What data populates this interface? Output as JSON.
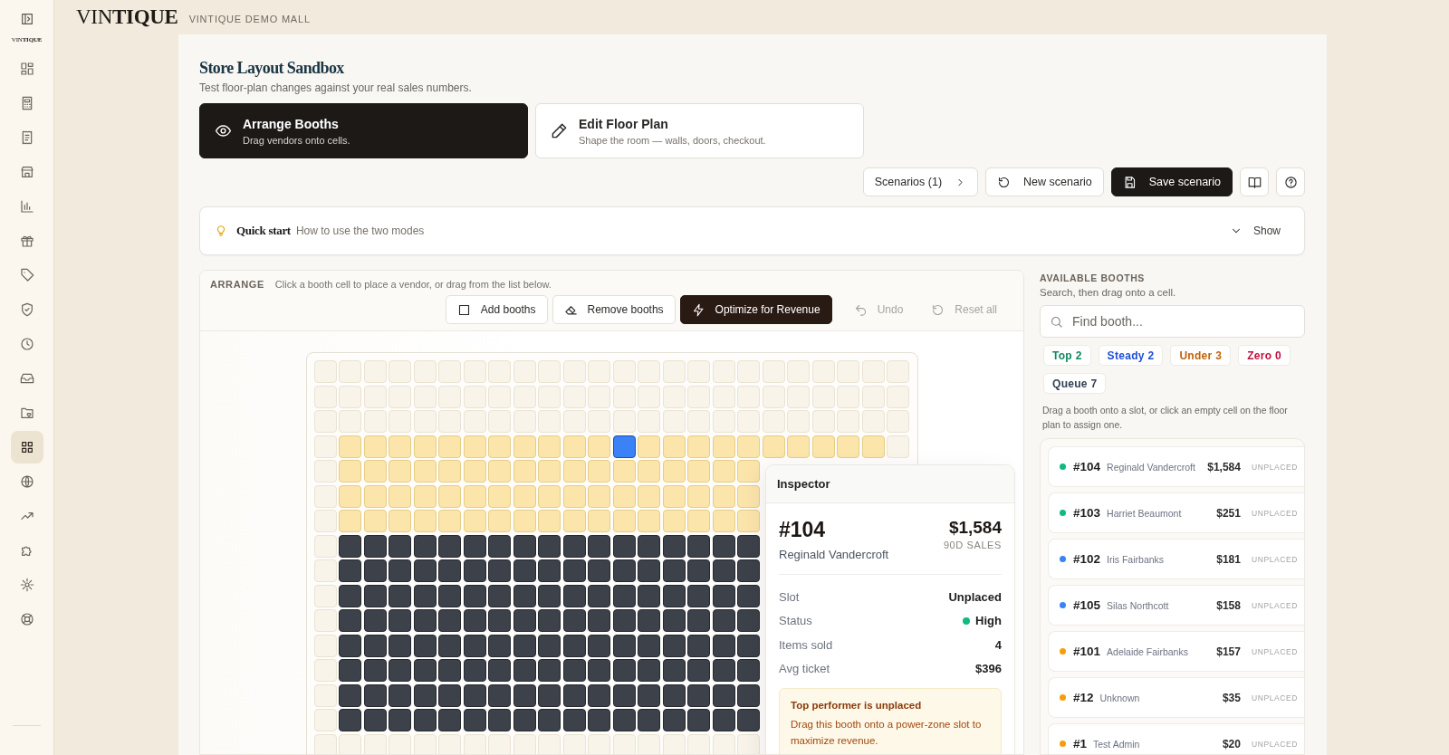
{
  "header": {
    "brand": "VIN**TIQUE**",
    "mall": "VINTIQUE DEMO MALL"
  },
  "sidebar": {
    "logo": "VIN**TIQUE**",
    "items": [
      {
        "selected": false
      },
      {
        "selected": false
      },
      {
        "selected": false
      },
      {
        "selected": false
      },
      {
        "selected": false
      },
      {
        "selected": false
      },
      {
        "selected": false
      },
      {
        "selected": false
      },
      {
        "selected": false
      },
      {
        "selected": false
      },
      {
        "selected": false
      },
      {
        "selected": true
      },
      {
        "selected": false
      },
      {
        "selected": false
      },
      {
        "selected": false
      },
      {
        "selected": false
      },
      {
        "selected": false
      }
    ]
  },
  "page": {
    "title": "Store Layout Sandbox",
    "subtitle": "Test floor-plan changes against your real sales numbers."
  },
  "modes": [
    {
      "title": "Arrange Booths",
      "subtitle": "Drag vendors onto cells.",
      "kind": "arrange",
      "selected": true
    },
    {
      "title": "Edit Floor Plan",
      "subtitle": "Shape the room — walls, doors, checkout.",
      "kind": "edit",
      "selected": false
    }
  ],
  "actions": [
    {
      "label": "Scenarios (1)",
      "kind": "menu"
    },
    {
      "label": "New scenario",
      "kind": "new"
    },
    {
      "label": "Save scenario",
      "kind": "save"
    }
  ],
  "quick_start": {
    "title": "Quick start",
    "description": "How to use the two modes",
    "toggle": "Show",
    "expanded": false
  },
  "arrange": {
    "label": "ARRANGE",
    "hint": "Click a booth cell to place a vendor, or drag from the list below.",
    "tools": [
      {
        "label": "Add booths",
        "kind": "add",
        "disabled": false
      },
      {
        "label": "Remove booths",
        "kind": "remove",
        "disabled": false
      },
      {
        "label": "Optimize for Revenue",
        "kind": "optimize",
        "disabled": false
      },
      {
        "label": "Undo",
        "kind": "undo",
        "disabled": true
      },
      {
        "label": "Reset all",
        "kind": "reset",
        "disabled": true
      }
    ]
  },
  "floor_plan": {
    "rows": [
      {
        "cells": [
          {
            "kind": "empty"
          },
          {
            "kind": "empty"
          },
          {
            "kind": "empty"
          },
          {
            "kind": "empty"
          },
          {
            "kind": "empty"
          },
          {
            "kind": "empty"
          },
          {
            "kind": "empty"
          },
          {
            "kind": "empty"
          },
          {
            "kind": "empty"
          },
          {
            "kind": "empty"
          },
          {
            "kind": "empty"
          },
          {
            "kind": "empty"
          },
          {
            "kind": "empty"
          },
          {
            "kind": "empty"
          },
          {
            "kind": "empty"
          },
          {
            "kind": "empty"
          },
          {
            "kind": "empty"
          },
          {
            "kind": "empty"
          },
          {
            "kind": "empty"
          },
          {
            "kind": "empty"
          },
          {
            "kind": "empty"
          },
          {
            "kind": "empty"
          },
          {
            "kind": "empty"
          },
          {
            "kind": "empty"
          }
        ]
      },
      {
        "cells": [
          {
            "kind": "empty"
          },
          {
            "kind": "empty"
          },
          {
            "kind": "empty"
          },
          {
            "kind": "empty"
          },
          {
            "kind": "empty"
          },
          {
            "kind": "empty"
          },
          {
            "kind": "empty"
          },
          {
            "kind": "empty"
          },
          {
            "kind": "empty"
          },
          {
            "kind": "empty"
          },
          {
            "kind": "empty"
          },
          {
            "kind": "empty"
          },
          {
            "kind": "empty"
          },
          {
            "kind": "empty"
          },
          {
            "kind": "empty"
          },
          {
            "kind": "empty"
          },
          {
            "kind": "empty"
          },
          {
            "kind": "empty"
          },
          {
            "kind": "empty"
          },
          {
            "kind": "empty"
          },
          {
            "kind": "empty"
          },
          {
            "kind": "empty"
          },
          {
            "kind": "empty"
          },
          {
            "kind": "empty"
          }
        ]
      },
      {
        "cells": [
          {
            "kind": "empty"
          },
          {
            "kind": "empty"
          },
          {
            "kind": "empty"
          },
          {
            "kind": "empty"
          },
          {
            "kind": "empty"
          },
          {
            "kind": "empty"
          },
          {
            "kind": "empty"
          },
          {
            "kind": "empty"
          },
          {
            "kind": "empty"
          },
          {
            "kind": "empty"
          },
          {
            "kind": "empty"
          },
          {
            "kind": "empty"
          },
          {
            "kind": "empty"
          },
          {
            "kind": "empty"
          },
          {
            "kind": "empty"
          },
          {
            "kind": "empty"
          },
          {
            "kind": "empty"
          },
          {
            "kind": "empty"
          },
          {
            "kind": "empty"
          },
          {
            "kind": "empty"
          },
          {
            "kind": "empty"
          },
          {
            "kind": "empty"
          },
          {
            "kind": "empty"
          },
          {
            "kind": "empty"
          }
        ]
      },
      {
        "cells": [
          {
            "kind": "empty"
          },
          {
            "kind": "power"
          },
          {
            "kind": "power"
          },
          {
            "kind": "power"
          },
          {
            "kind": "power"
          },
          {
            "kind": "power"
          },
          {
            "kind": "power"
          },
          {
            "kind": "power"
          },
          {
            "kind": "power"
          },
          {
            "kind": "power"
          },
          {
            "kind": "power"
          },
          {
            "kind": "power"
          },
          {
            "kind": "selected"
          },
          {
            "kind": "power"
          },
          {
            "kind": "power"
          },
          {
            "kind": "power"
          },
          {
            "kind": "power"
          },
          {
            "kind": "power"
          },
          {
            "kind": "power"
          },
          {
            "kind": "power"
          },
          {
            "kind": "power"
          },
          {
            "kind": "power"
          },
          {
            "kind": "power"
          },
          {
            "kind": "empty"
          }
        ]
      },
      {
        "cells": [
          {
            "kind": "empty"
          },
          {
            "kind": "power"
          },
          {
            "kind": "power"
          },
          {
            "kind": "power"
          },
          {
            "kind": "power"
          },
          {
            "kind": "power"
          },
          {
            "kind": "power"
          },
          {
            "kind": "power"
          },
          {
            "kind": "power"
          },
          {
            "kind": "power"
          },
          {
            "kind": "power"
          },
          {
            "kind": "power"
          },
          {
            "kind": "power"
          },
          {
            "kind": "power"
          },
          {
            "kind": "power"
          },
          {
            "kind": "power"
          },
          {
            "kind": "power"
          },
          {
            "kind": "power"
          }
        ]
      },
      {
        "cells": [
          {
            "kind": "empty"
          },
          {
            "kind": "power"
          },
          {
            "kind": "power"
          },
          {
            "kind": "power"
          },
          {
            "kind": "power"
          },
          {
            "kind": "power"
          },
          {
            "kind": "power"
          },
          {
            "kind": "power"
          },
          {
            "kind": "power"
          },
          {
            "kind": "power"
          },
          {
            "kind": "power"
          },
          {
            "kind": "power"
          },
          {
            "kind": "power"
          },
          {
            "kind": "power"
          },
          {
            "kind": "power"
          },
          {
            "kind": "power"
          },
          {
            "kind": "power"
          },
          {
            "kind": "power"
          }
        ]
      },
      {
        "cells": [
          {
            "kind": "empty"
          },
          {
            "kind": "power"
          },
          {
            "kind": "power"
          },
          {
            "kind": "power"
          },
          {
            "kind": "power"
          },
          {
            "kind": "power"
          },
          {
            "kind": "power"
          },
          {
            "kind": "power"
          },
          {
            "kind": "power"
          },
          {
            "kind": "power"
          },
          {
            "kind": "power"
          },
          {
            "kind": "power"
          },
          {
            "kind": "power"
          },
          {
            "kind": "power"
          },
          {
            "kind": "power"
          },
          {
            "kind": "power"
          },
          {
            "kind": "power"
          },
          {
            "kind": "power"
          }
        ]
      },
      {
        "cells": [
          {
            "kind": "empty"
          },
          {
            "kind": "standard"
          },
          {
            "kind": "standard"
          },
          {
            "kind": "standard"
          },
          {
            "kind": "standard"
          },
          {
            "kind": "standard"
          },
          {
            "kind": "standard"
          },
          {
            "kind": "standard"
          },
          {
            "kind": "standard"
          },
          {
            "kind": "standard"
          },
          {
            "kind": "standard"
          },
          {
            "kind": "standard"
          },
          {
            "kind": "standard"
          },
          {
            "kind": "standard"
          },
          {
            "kind": "standard"
          },
          {
            "kind": "standard"
          },
          {
            "kind": "standard"
          },
          {
            "kind": "standard"
          }
        ]
      },
      {
        "cells": [
          {
            "kind": "empty"
          },
          {
            "kind": "standard"
          },
          {
            "kind": "standard"
          },
          {
            "kind": "standard"
          },
          {
            "kind": "standard"
          },
          {
            "kind": "standard"
          },
          {
            "kind": "standard"
          },
          {
            "kind": "standard"
          },
          {
            "kind": "standard"
          },
          {
            "kind": "standard"
          },
          {
            "kind": "standard"
          },
          {
            "kind": "standard"
          },
          {
            "kind": "standard"
          },
          {
            "kind": "standard"
          },
          {
            "kind": "standard"
          },
          {
            "kind": "standard"
          },
          {
            "kind": "standard"
          },
          {
            "kind": "standard"
          }
        ]
      },
      {
        "cells": [
          {
            "kind": "empty"
          },
          {
            "kind": "standard"
          },
          {
            "kind": "standard"
          },
          {
            "kind": "standard"
          },
          {
            "kind": "standard"
          },
          {
            "kind": "standard"
          },
          {
            "kind": "standard"
          },
          {
            "kind": "standard"
          },
          {
            "kind": "standard"
          },
          {
            "kind": "standard"
          },
          {
            "kind": "standard"
          },
          {
            "kind": "standard"
          },
          {
            "kind": "standard"
          },
          {
            "kind": "standard"
          },
          {
            "kind": "standard"
          },
          {
            "kind": "standard"
          },
          {
            "kind": "standard"
          },
          {
            "kind": "standard"
          }
        ]
      },
      {
        "cells": [
          {
            "kind": "empty"
          },
          {
            "kind": "standard"
          },
          {
            "kind": "standard"
          },
          {
            "kind": "standard"
          },
          {
            "kind": "standard"
          },
          {
            "kind": "standard"
          },
          {
            "kind": "standard"
          },
          {
            "kind": "standard"
          },
          {
            "kind": "standard"
          },
          {
            "kind": "standard"
          },
          {
            "kind": "standard"
          },
          {
            "kind": "standard"
          },
          {
            "kind": "standard"
          },
          {
            "kind": "standard"
          },
          {
            "kind": "standard"
          },
          {
            "kind": "standard"
          },
          {
            "kind": "standard"
          },
          {
            "kind": "standard"
          }
        ]
      },
      {
        "cells": [
          {
            "kind": "empty"
          },
          {
            "kind": "standard"
          },
          {
            "kind": "standard"
          },
          {
            "kind": "standard"
          },
          {
            "kind": "standard"
          },
          {
            "kind": "standard"
          },
          {
            "kind": "standard"
          },
          {
            "kind": "standard"
          },
          {
            "kind": "standard"
          },
          {
            "kind": "standard"
          },
          {
            "kind": "standard"
          },
          {
            "kind": "standard"
          },
          {
            "kind": "standard"
          },
          {
            "kind": "standard"
          },
          {
            "kind": "standard"
          },
          {
            "kind": "standard"
          },
          {
            "kind": "standard"
          },
          {
            "kind": "standard"
          }
        ]
      },
      {
        "cells": [
          {
            "kind": "empty"
          },
          {
            "kind": "standard"
          },
          {
            "kind": "standard"
          },
          {
            "kind": "standard"
          },
          {
            "kind": "standard"
          },
          {
            "kind": "standard"
          },
          {
            "kind": "standard"
          },
          {
            "kind": "standard"
          },
          {
            "kind": "standard"
          },
          {
            "kind": "standard"
          },
          {
            "kind": "standard"
          },
          {
            "kind": "standard"
          },
          {
            "kind": "standard"
          },
          {
            "kind": "standard"
          },
          {
            "kind": "standard"
          },
          {
            "kind": "standard"
          },
          {
            "kind": "standard"
          },
          {
            "kind": "standard"
          }
        ]
      },
      {
        "cells": [
          {
            "kind": "empty"
          },
          {
            "kind": "standard"
          },
          {
            "kind": "standard"
          },
          {
            "kind": "standard"
          },
          {
            "kind": "standard"
          },
          {
            "kind": "standard"
          },
          {
            "kind": "standard"
          },
          {
            "kind": "standard"
          },
          {
            "kind": "standard"
          },
          {
            "kind": "standard"
          },
          {
            "kind": "standard"
          },
          {
            "kind": "standard"
          },
          {
            "kind": "standard"
          },
          {
            "kind": "standard"
          },
          {
            "kind": "standard"
          },
          {
            "kind": "standard"
          },
          {
            "kind": "standard"
          },
          {
            "kind": "standard"
          }
        ]
      },
      {
        "cells": [
          {
            "kind": "empty"
          },
          {
            "kind": "standard"
          },
          {
            "kind": "standard"
          },
          {
            "kind": "standard"
          },
          {
            "kind": "standard"
          },
          {
            "kind": "standard"
          },
          {
            "kind": "standard"
          },
          {
            "kind": "standard"
          },
          {
            "kind": "standard"
          },
          {
            "kind": "standard"
          },
          {
            "kind": "standard"
          },
          {
            "kind": "standard"
          },
          {
            "kind": "standard"
          },
          {
            "kind": "standard"
          },
          {
            "kind": "standard"
          },
          {
            "kind": "standard"
          },
          {
            "kind": "standard"
          },
          {
            "kind": "standard"
          }
        ]
      },
      {
        "cells": [
          {
            "kind": "empty"
          },
          {
            "kind": "empty"
          },
          {
            "kind": "empty"
          },
          {
            "kind": "empty"
          },
          {
            "kind": "empty"
          },
          {
            "kind": "empty"
          },
          {
            "kind": "empty"
          },
          {
            "kind": "empty"
          },
          {
            "kind": "empty"
          },
          {
            "kind": "empty"
          },
          {
            "kind": "empty"
          },
          {
            "kind": "empty"
          },
          {
            "kind": "empty"
          },
          {
            "kind": "empty"
          },
          {
            "kind": "empty"
          },
          {
            "kind": "empty"
          },
          {
            "kind": "empty"
          },
          {
            "kind": "empty"
          }
        ]
      }
    ]
  },
  "inspector": {
    "title": "Inspector",
    "booth": "#104",
    "vendor": "Reginald Vandercroft",
    "amount": "$1,584",
    "amount_label": "90D SALES",
    "fields": [
      {
        "label": "Slot",
        "value": "Unplaced"
      },
      {
        "label": "Status",
        "value": "High",
        "color": "#10b981"
      },
      {
        "label": "Items sold",
        "value": "4"
      },
      {
        "label": "Avg ticket",
        "value": "$396"
      }
    ],
    "alert": {
      "title": "Top performer is unplaced",
      "text": "Drag this booth onto a power-zone slot to maximize revenue."
    }
  },
  "available": {
    "title": "AVAILABLE BOOTHS",
    "subtitle": "Search, then drag onto a cell.",
    "search": {
      "placeholder": "Find booth..."
    },
    "filters": [
      {
        "label": "Top 2",
        "color": "#0f8a5f"
      },
      {
        "label": "Steady 2",
        "color": "#1d4ed8"
      },
      {
        "label": "Under 3",
        "color": "#c2620a"
      },
      {
        "label": "Zero 0",
        "color": "#be123c"
      },
      {
        "label": "Queue 7",
        "color": "#334155"
      }
    ],
    "hint": "Drag a booth onto a slot, or click an empty cell on the floor plan to assign one.",
    "booths": [
      {
        "id": "#104",
        "vendor": "Reginald Vandercroft",
        "amount": "$1,584",
        "status": "UNPLACED",
        "color": "#10b981"
      },
      {
        "id": "#103",
        "vendor": "Harriet Beaumont",
        "amount": "$251",
        "status": "UNPLACED",
        "color": "#10b981"
      },
      {
        "id": "#102",
        "vendor": "Iris Fairbanks",
        "amount": "$181",
        "status": "UNPLACED",
        "color": "#3b82f6"
      },
      {
        "id": "#105",
        "vendor": "Silas Northcott",
        "amount": "$158",
        "status": "UNPLACED",
        "color": "#3b82f6"
      },
      {
        "id": "#101",
        "vendor": "Adelaide Fairbanks",
        "amount": "$157",
        "status": "UNPLACED",
        "color": "#f59e0b"
      },
      {
        "id": "#12",
        "vendor": "Unknown",
        "amount": "$35",
        "status": "UNPLACED",
        "color": "#f59e0b"
      },
      {
        "id": "#1",
        "vendor": "Test Admin",
        "amount": "$20",
        "status": "UNPLACED",
        "color": "#f59e0b"
      }
    ]
  }
}
